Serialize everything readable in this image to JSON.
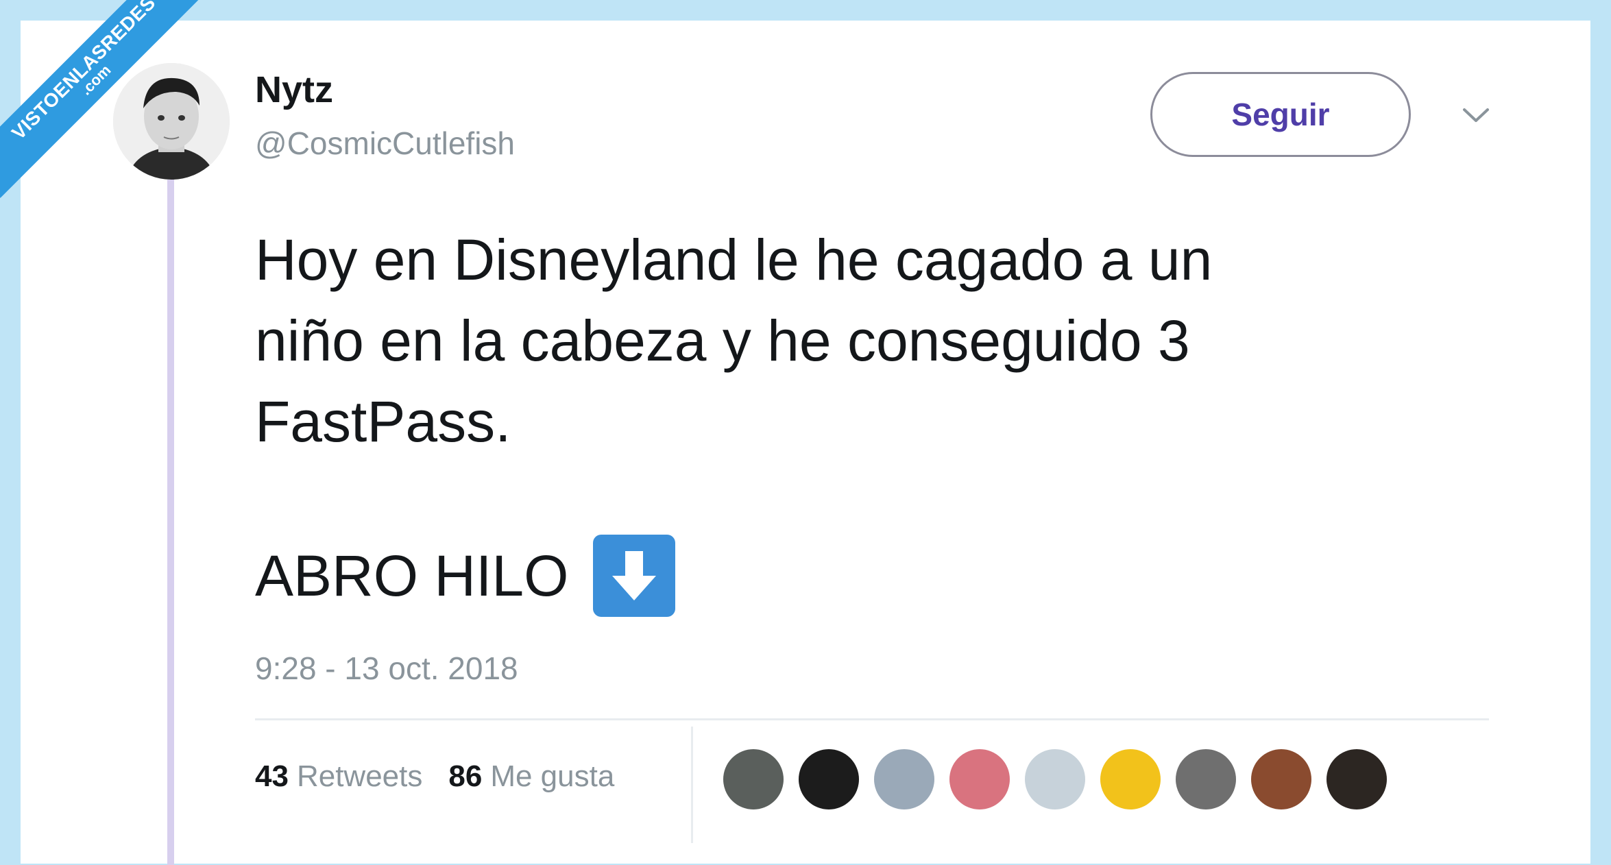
{
  "watermark": {
    "line1": "VISTOENLASREDES",
    "line2": ".com"
  },
  "tweet": {
    "name": "Nytz",
    "handle": "@CosmicCutlefish",
    "follow_label": "Seguir",
    "text_lines": [
      "Hoy en Disneyland le he cagado a un",
      "niño en la cabeza y he conseguido 3",
      "FastPass."
    ],
    "text2": "ABRO HILO",
    "emoji": "down-arrow-button",
    "timestamp": "9:28 - 13 oct. 2018",
    "retweets_count": "43",
    "retweets_label": "Retweets",
    "likes_count": "86",
    "likes_label": "Me gusta"
  },
  "colors": {
    "background": "#bfe4f6",
    "watermark": "#2f9be0",
    "follow_text": "#4f3ea8",
    "thread_line": "#d7cfee",
    "emoji_blue": "#3b8fd9"
  },
  "likers": [
    {
      "name": "liker-avatar-1",
      "color": "#5a5f5c"
    },
    {
      "name": "liker-avatar-2",
      "color": "#1c1c1c"
    },
    {
      "name": "liker-avatar-3",
      "color": "#9aa9b8"
    },
    {
      "name": "liker-avatar-4",
      "color": "#d9737f"
    },
    {
      "name": "liker-avatar-5",
      "color": "#c7d2da"
    },
    {
      "name": "liker-avatar-6",
      "color": "#f2c21b"
    },
    {
      "name": "liker-avatar-7",
      "color": "#6f6f6f"
    },
    {
      "name": "liker-avatar-8",
      "color": "#8a4b2f"
    },
    {
      "name": "liker-avatar-9",
      "color": "#2c2622"
    }
  ]
}
